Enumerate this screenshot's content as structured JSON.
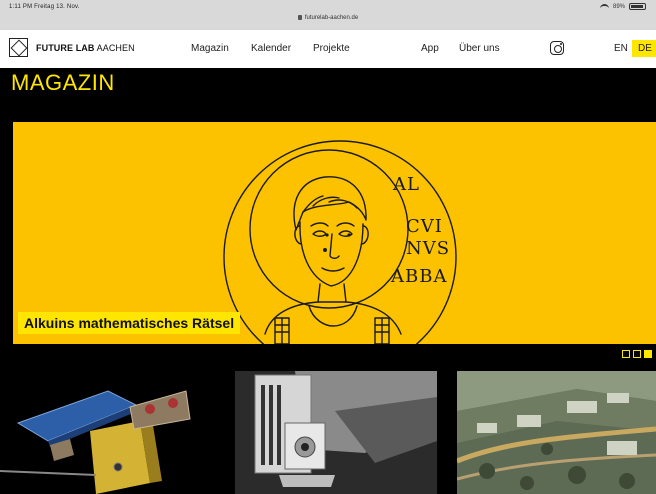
{
  "statusbar": {
    "time": "1:11 PM  Freitag 13. Nov.",
    "url": "futurelab-aachen.de",
    "battery": "89%"
  },
  "nav": {
    "logo_bold": "FUTURE LAB",
    "logo_light": "AACHEN",
    "items": [
      "Magazin",
      "Kalender",
      "Projekte",
      "App",
      "Über uns"
    ],
    "languages": [
      "EN",
      "DE"
    ],
    "active_language": "DE"
  },
  "page": {
    "title": "MAGAZIN",
    "hero": {
      "caption": "Alkuins mathematisches Rätsel",
      "inscription": [
        "AL",
        "CVI",
        "NVS",
        "ABBA"
      ],
      "background_color": "#fcc200"
    },
    "carousel_dots": 3,
    "carousel_active": 3
  },
  "colors": {
    "accent": "#ffe600",
    "background": "#000000",
    "hero": "#fcc200"
  }
}
